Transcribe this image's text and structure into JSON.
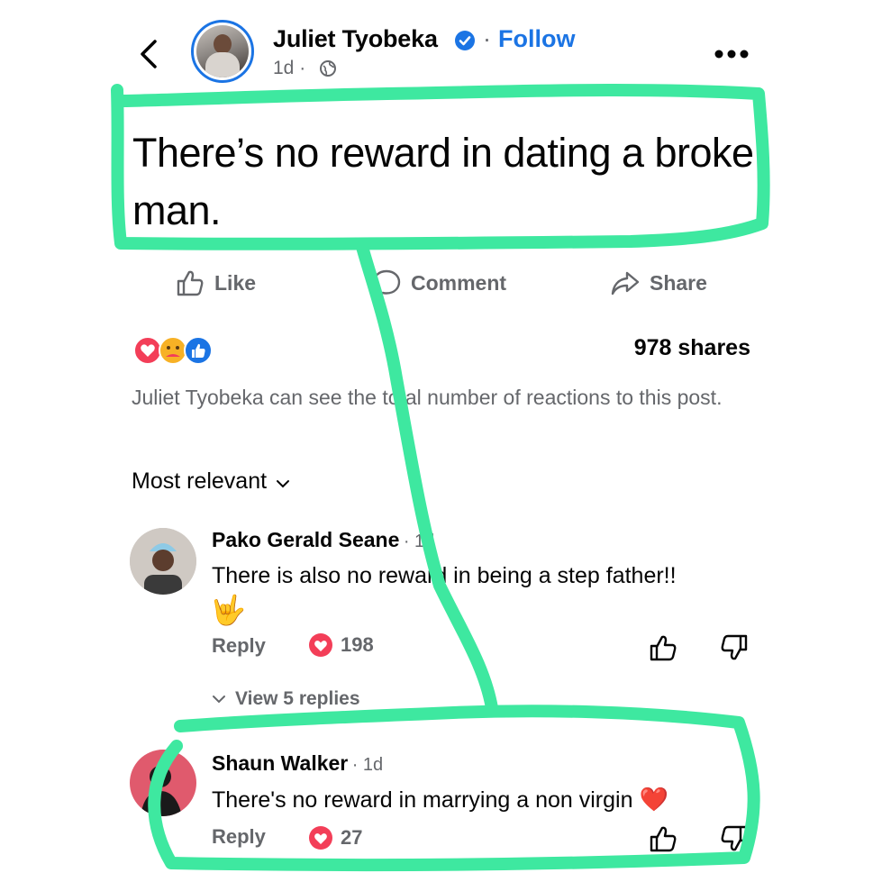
{
  "post": {
    "author": "Juliet Tyobeka",
    "separator": "·",
    "follow_label": "Follow",
    "time": "1d ·",
    "text": "There’s no reward in dating a broke man.",
    "actions": {
      "like": "Like",
      "comment": "Comment",
      "share": "Share"
    },
    "shares": "978 shares",
    "notice": "Juliet Tyobeka can see the total number of reactions to this post."
  },
  "comments": {
    "sort_label": "Most relevant",
    "items": [
      {
        "name": "Pako Gerald Seane",
        "time": "· 1d",
        "text": "There is also no reward in being a step father!!",
        "emoji": "🤟",
        "reply_label": "Reply",
        "reaction_count": "198",
        "view_replies": "View 5 replies"
      },
      {
        "name": "Shaun Walker",
        "time": "· 1d",
        "text": "There's no reward in marrying a non virgin",
        "emoji": "❤️",
        "reply_label": "Reply",
        "reaction_count": "27"
      }
    ]
  },
  "icons": {
    "back": "chevron-left-icon",
    "verified": "verified-badge-icon",
    "globe": "globe-icon",
    "more": "more-icon",
    "like": "thumbs-up-icon",
    "comment": "comment-bubble-icon",
    "share": "share-arrow-icon",
    "dislike": "thumbs-down-icon",
    "heart": "heart-icon"
  },
  "colors": {
    "accent": "#1b74e4",
    "secondary_text": "#65676b",
    "heart": "#f33e58",
    "marker": "#3ee8a0"
  }
}
